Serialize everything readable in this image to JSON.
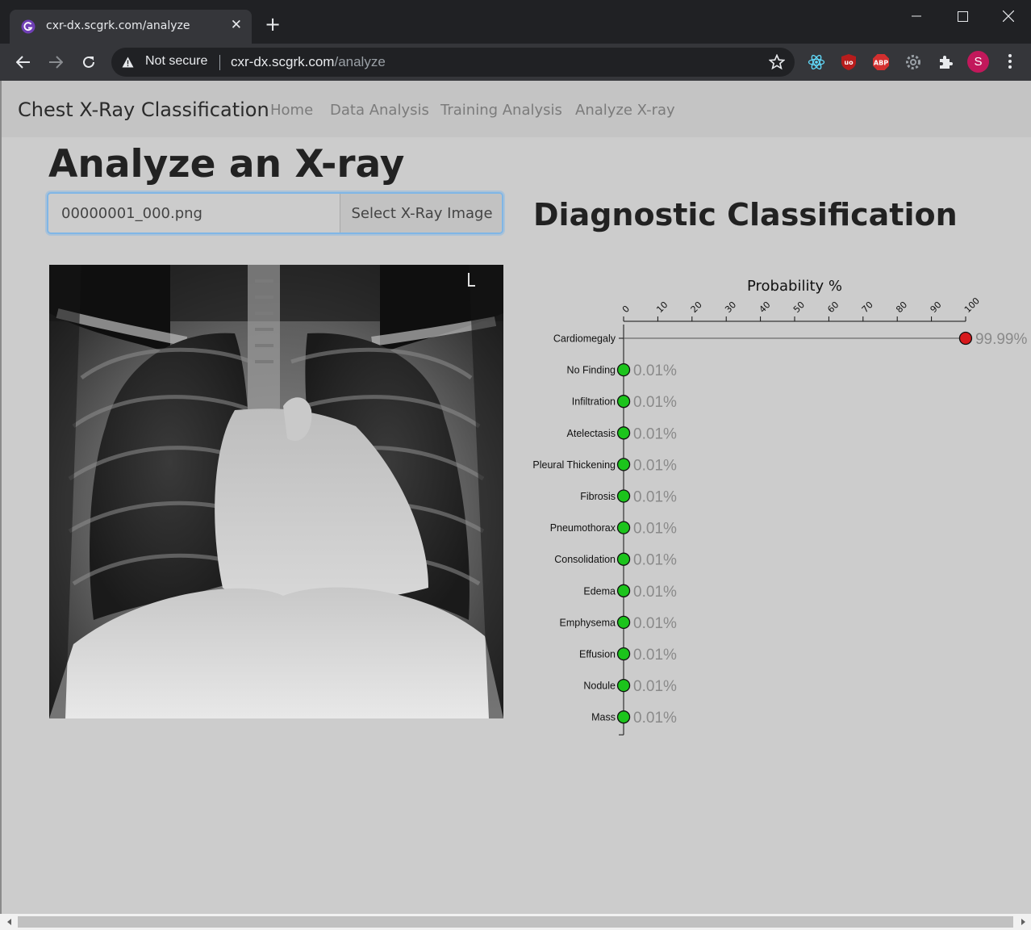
{
  "browser": {
    "tab_title": "cxr-dx.scgrk.com/analyze",
    "security_label": "Not secure",
    "url_host": "cxr-dx.scgrk.com",
    "url_path": "/analyze",
    "profile_initial": "S",
    "icons": [
      "back-icon",
      "forward-icon",
      "reload-icon",
      "warning-icon",
      "star-icon",
      "react-devtools-icon",
      "ublock-icon",
      "adblock-plus-icon",
      "settings-extension-icon",
      "extensions-puzzle-icon",
      "more-menu-icon"
    ],
    "colors": {
      "frame": "#202124",
      "toolbar": "#35363a",
      "avatar": "#c2185b",
      "abp": "#d32f2f",
      "ublock": "#b71c1c"
    }
  },
  "navbar": {
    "brand": "Chest X-Ray Classification",
    "links": [
      "Home",
      "Data Analysis",
      "Training Analysis",
      "Analyze X-ray"
    ]
  },
  "main": {
    "heading": "Analyze an X-ray",
    "file_input": {
      "value": "00000001_000.png",
      "button_label": "Select X-Ray Image"
    },
    "results_heading": "Diagnostic Classification"
  },
  "chart_data": {
    "type": "scatter",
    "title": "Probability %",
    "xlim": [
      0,
      100
    ],
    "x_ticks": [
      "0",
      "10",
      "20",
      "30",
      "40",
      "50",
      "60",
      "70",
      "80",
      "90",
      "100"
    ],
    "categories": [
      "Cardiomegaly",
      "No Finding",
      "Infiltration",
      "Atelectasis",
      "Pleural Thickening",
      "Fibrosis",
      "Pneumothorax",
      "Consolidation",
      "Edema",
      "Emphysema",
      "Effusion",
      "Nodule",
      "Mass"
    ],
    "values": [
      99.99,
      0.01,
      0.01,
      0.01,
      0.01,
      0.01,
      0.01,
      0.01,
      0.01,
      0.01,
      0.01,
      0.01,
      0.01
    ],
    "value_labels": [
      "99.99%",
      "0.01%",
      "0.01%",
      "0.01%",
      "0.01%",
      "0.01%",
      "0.01%",
      "0.01%",
      "0.01%",
      "0.01%",
      "0.01%",
      "0.01%",
      "0.01%"
    ],
    "colors": {
      "high": "#d7191c",
      "low": "#1cc41c",
      "label": "#8a8a8a"
    }
  }
}
